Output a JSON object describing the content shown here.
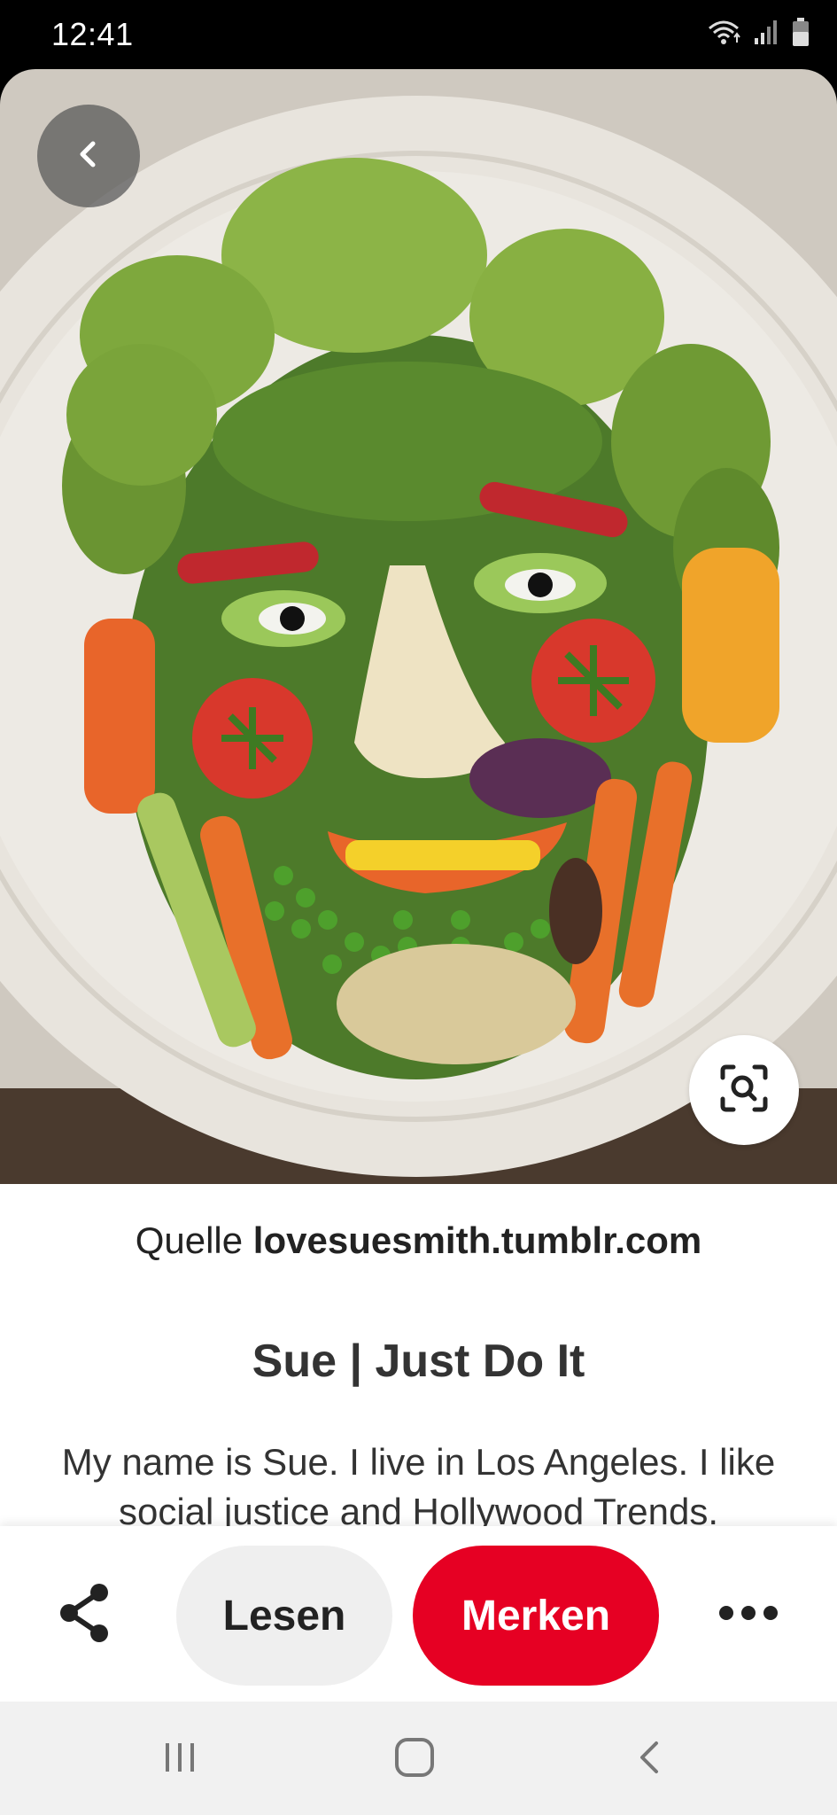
{
  "status_bar": {
    "time": "12:41",
    "icons": [
      "wifi-icon",
      "signal-icon",
      "battery-icon"
    ]
  },
  "hero": {
    "image_description_icon": "vegetable-face-image",
    "back_icon": "chevron-left-icon",
    "visual_search_icon": "visual-search-icon"
  },
  "source": {
    "prefix": "Quelle",
    "domain": "lovesuesmith.tumblr.com"
  },
  "pin": {
    "title": "Sue | Just Do It",
    "description": "My name is Sue. I live in Los Angeles. I like social justice and Hollywood Trends."
  },
  "actions": {
    "share_icon": "share-icon",
    "read_label": "Lesen",
    "save_label": "Merken",
    "more_icon": "more-icon"
  },
  "colors": {
    "accent": "#e60023",
    "secondary_button": "#efefef"
  },
  "nav": {
    "icons": [
      "recents-icon",
      "home-icon",
      "back-icon"
    ]
  }
}
